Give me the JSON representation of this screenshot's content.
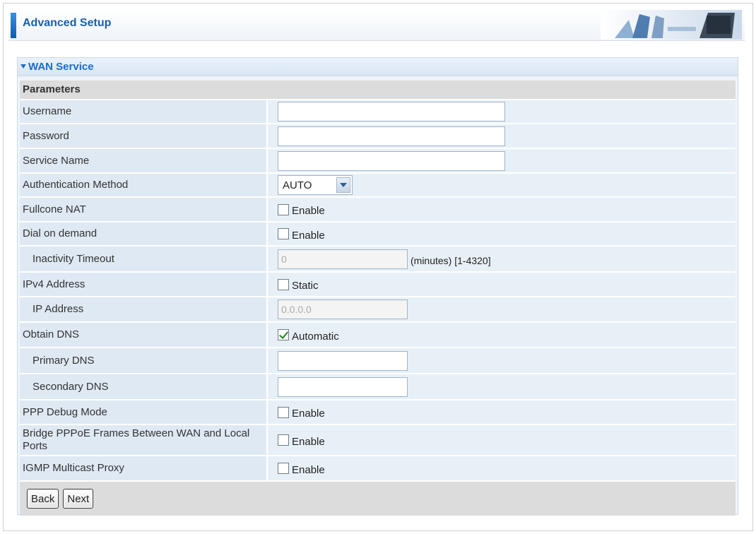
{
  "header": {
    "title": "Advanced Setup"
  },
  "panel": {
    "title": "WAN Service"
  },
  "params": {
    "heading": "Parameters"
  },
  "rows": {
    "username": {
      "label": "Username",
      "value": ""
    },
    "password": {
      "label": "Password",
      "value": ""
    },
    "service_name": {
      "label": "Service Name",
      "value": ""
    },
    "auth_method": {
      "label": "Authentication Method",
      "selected": "AUTO"
    },
    "fullcone_nat": {
      "label": "Fullcone NAT",
      "checkbox": "Enable",
      "checked": false
    },
    "dial_on_demand": {
      "label": "Dial on demand",
      "checkbox": "Enable",
      "checked": false
    },
    "inactivity_timeout": {
      "label": "Inactivity Timeout",
      "value": "0",
      "unit": "(minutes)  [1-4320]"
    },
    "ipv4_address": {
      "label": "IPv4 Address",
      "checkbox": "Static",
      "checked": false
    },
    "ip_address": {
      "label": "IP Address",
      "value": "0.0.0.0"
    },
    "obtain_dns": {
      "label": "Obtain DNS",
      "checkbox": "Automatic",
      "checked": true
    },
    "primary_dns": {
      "label": "Primary DNS",
      "value": ""
    },
    "secondary_dns": {
      "label": "Secondary DNS",
      "value": ""
    },
    "ppp_debug": {
      "label": "PPP Debug Mode",
      "checkbox": "Enable",
      "checked": false
    },
    "bridge_pppoe": {
      "label": "Bridge PPPoE Frames Between WAN and Local Ports",
      "checkbox": "Enable",
      "checked": false
    },
    "igmp_proxy": {
      "label": "IGMP Multicast Proxy",
      "checkbox": "Enable",
      "checked": false
    }
  },
  "buttons": {
    "back": "Back",
    "next": "Next"
  },
  "colors": {
    "accent": "#1d6cc4",
    "label_bg": "#dfe9f3",
    "value_bg": "#e8f0f7",
    "heading_bg": "#dcdcdc"
  }
}
